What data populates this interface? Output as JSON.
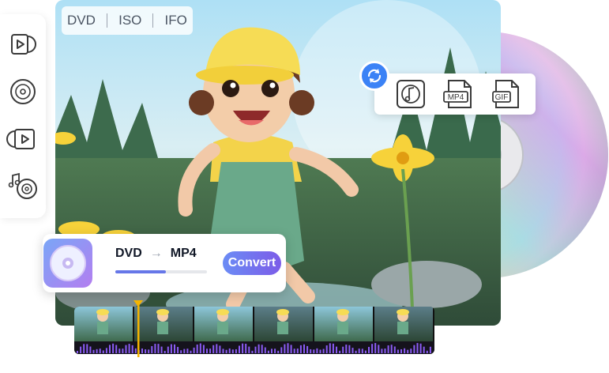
{
  "format_tabs": [
    "DVD",
    "ISO",
    "IFO"
  ],
  "output_formats": [
    "MP4",
    "GIF"
  ],
  "conversion": {
    "source": "DVD",
    "arrow": "→",
    "target": "MP4",
    "progress": 0.55,
    "button_label": "Convert"
  },
  "left_icons": [
    "dvd-play-icon",
    "disc-icon",
    "dvd-folder-icon",
    "music-disc-icon"
  ],
  "colors": {
    "accent_blue": "#3b82f6",
    "button_start": "#6b8cf5",
    "button_end": "#7c5ce8",
    "playhead": "#f5b400",
    "waveform": "#8b5cf6"
  }
}
